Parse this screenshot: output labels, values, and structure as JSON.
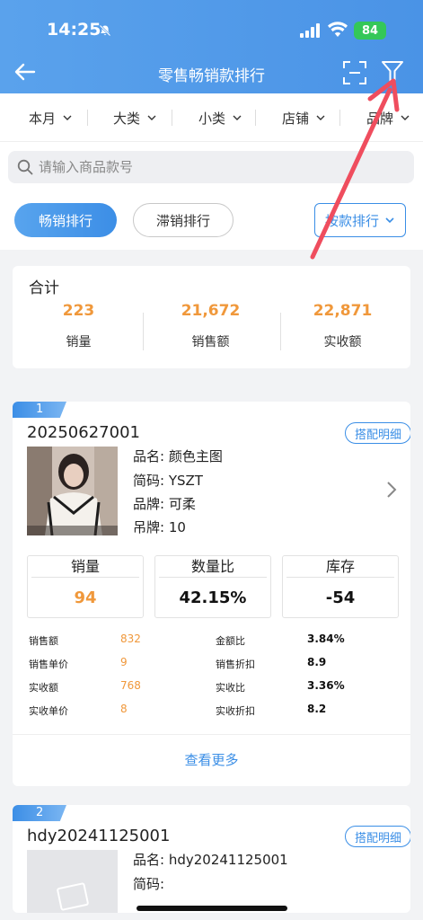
{
  "status_bar": {
    "time": "14:25",
    "battery": "84"
  },
  "nav": {
    "title": "零售畅销款排行"
  },
  "filters": [
    "本月",
    "大类",
    "小类",
    "店铺",
    "品牌"
  ],
  "search": {
    "placeholder": "请输入商品款号"
  },
  "tabs": {
    "active": "畅销排行",
    "inactive": "滞销排行",
    "sort": "按款排行"
  },
  "summary": {
    "title": "合计",
    "stats": [
      {
        "value": "223",
        "label": "销量"
      },
      {
        "value": "21,672",
        "label": "销售额"
      },
      {
        "value": "22,871",
        "label": "实收额"
      }
    ]
  },
  "items": [
    {
      "rank": "1",
      "sku": "20250627001",
      "match": "搭配明细",
      "lines": [
        "品名: 颜色主图",
        "简码: YSZT",
        "品牌: 可柔",
        "吊牌: 10"
      ],
      "metrics": [
        {
          "label": "销量",
          "value": "94",
          "color": "#f0983b"
        },
        {
          "label": "数量比",
          "value": "42.15%",
          "color": "#111111"
        },
        {
          "label": "库存",
          "value": "-54",
          "color": "#111111"
        }
      ],
      "details_left": [
        {
          "label": "销售额",
          "value": "832"
        },
        {
          "label": "销售单价",
          "value": "9"
        },
        {
          "label": "实收额",
          "value": "768"
        },
        {
          "label": "实收单价",
          "value": "8"
        }
      ],
      "details_right": [
        {
          "label": "金额比",
          "value": "3.84%"
        },
        {
          "label": "销售折扣",
          "value": "8.9"
        },
        {
          "label": "实收比",
          "value": "3.36%"
        },
        {
          "label": "实收折扣",
          "value": "8.2"
        }
      ],
      "more": "查看更多"
    },
    {
      "rank": "2",
      "sku": "hdy20241125001",
      "match": "搭配明细",
      "lines": [
        "品名: hdy20241125001",
        "简码:"
      ]
    }
  ],
  "colors": {
    "accent": "#3a8ee6",
    "orange": "#f0983b",
    "header": "#4a93e6",
    "annotation": "#ef4d5e"
  }
}
